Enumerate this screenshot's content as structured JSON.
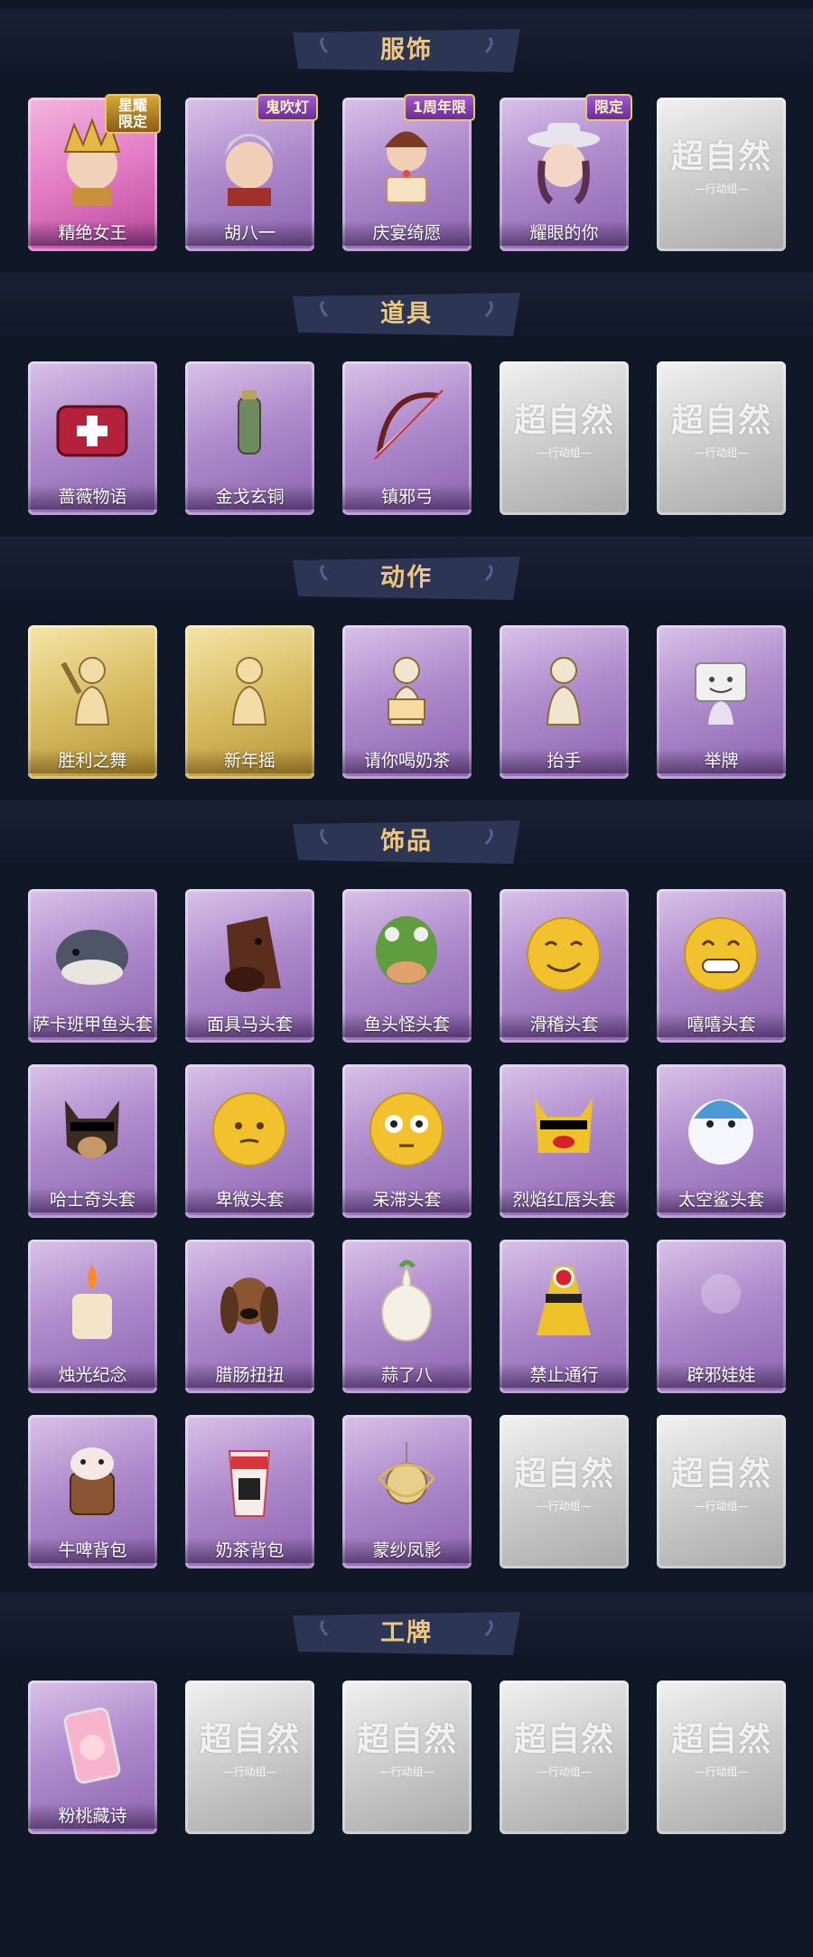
{
  "colors": {
    "background": "#101727",
    "banner": "#2c3553",
    "title": "#f0c77e",
    "card_purple": "#b08bcd",
    "card_gold": "#d8bc62",
    "card_empty": "#c8c8c8"
  },
  "empty_card": {
    "logo": "超自然",
    "sub": "—行动组—"
  },
  "sections": [
    {
      "title": "服饰",
      "rows": [
        [
          {
            "label": "精绝女王",
            "style": "pink",
            "icon": "queen-portrait-icon",
            "tag": "星耀\n限定"
          },
          {
            "label": "胡八一",
            "style": "purple",
            "icon": "young-man-portrait-icon",
            "tag": "鬼吹灯"
          },
          {
            "label": "庆宴绮愿",
            "style": "purple",
            "icon": "cake-girl-portrait-icon",
            "tag": "1周年限"
          },
          {
            "label": "耀眼的你",
            "style": "purple",
            "icon": "cowgirl-portrait-icon",
            "tag": "限定"
          },
          {
            "label": "",
            "style": "empty",
            "icon": "empty-slot-icon",
            "tag": ""
          }
        ]
      ]
    },
    {
      "title": "道具",
      "rows": [
        [
          {
            "label": "蔷薇物语",
            "style": "purple",
            "icon": "medkit-icon",
            "tag": ""
          },
          {
            "label": "金戈玄铜",
            "style": "purple",
            "icon": "bronze-grenade-icon",
            "tag": ""
          },
          {
            "label": "镇邪弓",
            "style": "purple",
            "icon": "bow-icon",
            "tag": ""
          },
          {
            "label": "",
            "style": "empty",
            "icon": "empty-slot-icon",
            "tag": ""
          },
          {
            "label": "",
            "style": "empty",
            "icon": "empty-slot-icon",
            "tag": ""
          }
        ]
      ]
    },
    {
      "title": "动作",
      "rows": [
        [
          {
            "label": "胜利之舞",
            "style": "gold",
            "icon": "victory-dance-icon",
            "tag": ""
          },
          {
            "label": "新年摇",
            "style": "gold",
            "icon": "new-year-shake-icon",
            "tag": ""
          },
          {
            "label": "请你喝奶茶",
            "style": "purple",
            "icon": "milk-tea-pose-icon",
            "tag": ""
          },
          {
            "label": "抬手",
            "style": "purple",
            "icon": "raise-hand-icon",
            "tag": ""
          },
          {
            "label": "举牌",
            "style": "purple",
            "icon": "hold-sign-icon",
            "tag": ""
          }
        ]
      ]
    },
    {
      "title": "饰品",
      "rows": [
        [
          {
            "label": "萨卡班甲鱼头套",
            "style": "purple",
            "icon": "fish-head-mask-icon",
            "tag": ""
          },
          {
            "label": "面具马头套",
            "style": "purple",
            "icon": "horse-head-mask-icon",
            "tag": ""
          },
          {
            "label": "鱼头怪头套",
            "style": "purple",
            "icon": "fishman-mask-icon",
            "tag": ""
          },
          {
            "label": "滑稽头套",
            "style": "purple",
            "icon": "funny-face-mask-icon",
            "tag": ""
          },
          {
            "label": "嘻嘻头套",
            "style": "purple",
            "icon": "grin-face-mask-icon",
            "tag": ""
          }
        ],
        [
          {
            "label": "哈士奇头套",
            "style": "purple",
            "icon": "husky-mask-icon",
            "tag": ""
          },
          {
            "label": "卑微头套",
            "style": "purple",
            "icon": "humble-face-mask-icon",
            "tag": ""
          },
          {
            "label": "呆滞头套",
            "style": "purple",
            "icon": "stunned-face-mask-icon",
            "tag": ""
          },
          {
            "label": "烈焰红唇头套",
            "style": "purple",
            "icon": "red-lips-mask-icon",
            "tag": ""
          },
          {
            "label": "太空鲨头套",
            "style": "purple",
            "icon": "space-shark-mask-icon",
            "tag": ""
          }
        ],
        [
          {
            "label": "烛光纪念",
            "style": "purple",
            "icon": "candle-icon",
            "tag": ""
          },
          {
            "label": "腊肠扭扭",
            "style": "purple",
            "icon": "dachshund-icon",
            "tag": ""
          },
          {
            "label": "蒜了八",
            "style": "purple",
            "icon": "garlic-icon",
            "tag": ""
          },
          {
            "label": "禁止通行",
            "style": "purple",
            "icon": "traffic-cone-icon",
            "tag": ""
          },
          {
            "label": "辟邪娃娃",
            "style": "purple",
            "icon": "charm-doll-icon",
            "tag": ""
          }
        ],
        [
          {
            "label": "牛啤背包",
            "style": "purple",
            "icon": "beer-cow-backpack-icon",
            "tag": ""
          },
          {
            "label": "奶茶背包",
            "style": "purple",
            "icon": "milk-tea-backpack-icon",
            "tag": ""
          },
          {
            "label": "蒙纱凤影",
            "style": "purple",
            "icon": "phoenix-pendant-icon",
            "tag": ""
          },
          {
            "label": "",
            "style": "empty",
            "icon": "empty-slot-icon",
            "tag": ""
          },
          {
            "label": "",
            "style": "empty",
            "icon": "empty-slot-icon",
            "tag": ""
          }
        ]
      ]
    },
    {
      "title": "工牌",
      "rows": [
        [
          {
            "label": "粉桃藏诗",
            "style": "purple",
            "icon": "pink-peach-badge-icon",
            "tag": ""
          },
          {
            "label": "",
            "style": "empty",
            "icon": "empty-slot-icon",
            "tag": ""
          },
          {
            "label": "",
            "style": "empty",
            "icon": "empty-slot-icon",
            "tag": ""
          },
          {
            "label": "",
            "style": "empty",
            "icon": "empty-slot-icon",
            "tag": ""
          },
          {
            "label": "",
            "style": "empty",
            "icon": "empty-slot-icon",
            "tag": ""
          }
        ]
      ]
    }
  ]
}
